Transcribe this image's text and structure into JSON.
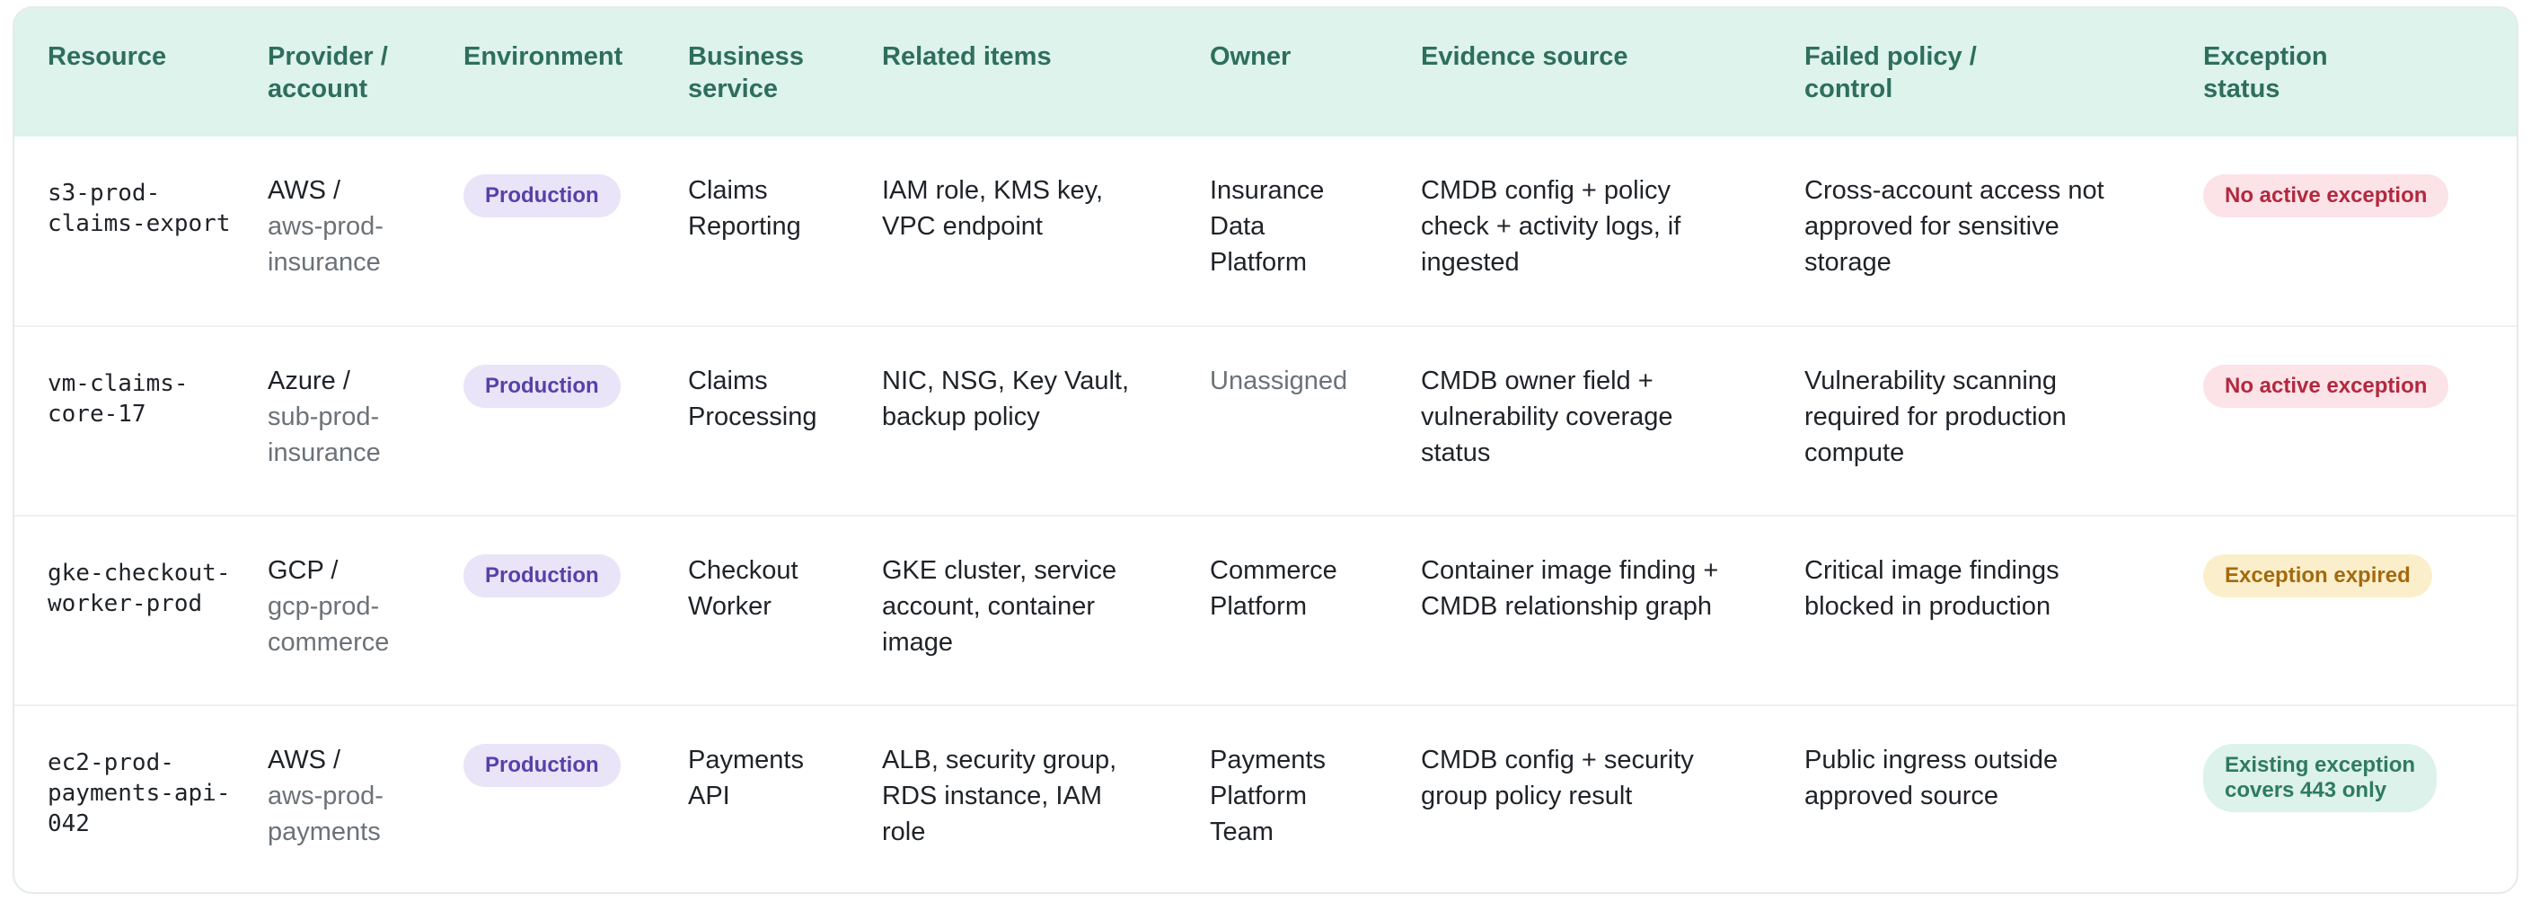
{
  "columns": [
    [
      "Resource"
    ],
    [
      "Provider /",
      "account"
    ],
    [
      "Environment"
    ],
    [
      "Business",
      "service"
    ],
    [
      "Related items"
    ],
    [
      "Owner"
    ],
    [
      "Evidence source"
    ],
    [
      "Failed policy /",
      "control"
    ],
    [
      "Exception",
      "status"
    ]
  ],
  "rows": [
    {
      "resource": [
        "s3-prod-",
        "claims-export"
      ],
      "provider": "AWS /",
      "account": [
        "aws-prod-",
        "insurance"
      ],
      "environment": "Production",
      "service": [
        "Claims",
        "Reporting"
      ],
      "related": [
        "IAM role, KMS key,",
        "VPC endpoint"
      ],
      "owner": [
        "Insurance",
        "Data",
        "Platform"
      ],
      "owner_muted": false,
      "evidence": [
        "CMDB config + policy",
        "check + activity logs, if",
        "ingested"
      ],
      "policy": [
        "Cross-account access not",
        "approved for sensitive",
        "storage"
      ],
      "status": [
        "No active exception"
      ],
      "status_tone": "red"
    },
    {
      "resource": [
        "vm-claims-",
        "core-17"
      ],
      "provider": "Azure /",
      "account": [
        "sub-prod-",
        "insurance"
      ],
      "environment": "Production",
      "service": [
        "Claims",
        "Processing"
      ],
      "related": [
        "NIC, NSG, Key Vault,",
        "backup policy"
      ],
      "owner": [
        "Unassigned"
      ],
      "owner_muted": true,
      "evidence": [
        "CMDB owner field +",
        "vulnerability coverage",
        "status"
      ],
      "policy": [
        "Vulnerability scanning",
        "required for production",
        "compute"
      ],
      "status": [
        "No active exception"
      ],
      "status_tone": "red"
    },
    {
      "resource": [
        "gke-checkout-",
        "worker-prod"
      ],
      "provider": "GCP /",
      "account": [
        "gcp-prod-",
        "commerce"
      ],
      "environment": "Production",
      "service": [
        "Checkout",
        "Worker"
      ],
      "related": [
        "GKE cluster, service",
        "account, container",
        "image"
      ],
      "owner": [
        "Commerce",
        "Platform"
      ],
      "owner_muted": false,
      "evidence": [
        "Container image finding +",
        "CMDB relationship graph"
      ],
      "policy": [
        "Critical image findings",
        "blocked in production"
      ],
      "status": [
        "Exception expired"
      ],
      "status_tone": "amber"
    },
    {
      "resource": [
        "ec2-prod-",
        "payments-api-",
        "042"
      ],
      "provider": "AWS /",
      "account": [
        "aws-prod-",
        "payments"
      ],
      "environment": "Production",
      "service": [
        "Payments",
        "API"
      ],
      "related": [
        "ALB, security group,",
        "RDS instance, IAM",
        "role"
      ],
      "owner": [
        "Payments",
        "Platform",
        "Team"
      ],
      "owner_muted": false,
      "evidence": [
        "CMDB config + security",
        "group policy result"
      ],
      "policy": [
        "Public ingress outside",
        "approved source"
      ],
      "status": [
        "Existing exception",
        "covers 443 only"
      ],
      "status_tone": "green"
    }
  ]
}
